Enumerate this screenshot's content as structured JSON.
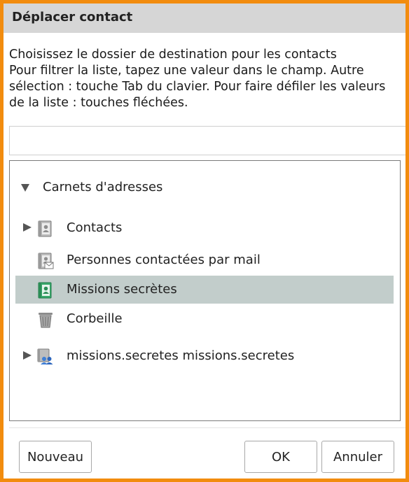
{
  "dialog": {
    "title": "Déplacer contact",
    "instructions": [
      "Choisissez le dossier de destination pour les contacts",
      "Pour filtrer la liste, tapez une valeur dans le champ. Autre",
      "sélection : touche Tab du clavier. Pour faire défiler les valeurs",
      "de la liste : touches fléchées."
    ]
  },
  "filter": {
    "value": "",
    "placeholder": ""
  },
  "tree": {
    "root": {
      "label": "Carnets d'adresses",
      "expanded": true
    },
    "items": [
      {
        "label": "Contacts",
        "icon": "address-book-icon",
        "has_children": true,
        "selected": false
      },
      {
        "label": "Personnes contactées par mail",
        "icon": "emailed-contacts-icon",
        "has_children": false,
        "selected": false
      },
      {
        "label": "Missions secrètes",
        "icon": "address-book-green-icon",
        "has_children": false,
        "selected": true
      },
      {
        "label": "Corbeille",
        "icon": "trash-icon",
        "has_children": false,
        "selected": false
      },
      {
        "label": "missions.secretes missions.secretes",
        "icon": "shared-folder-icon",
        "has_children": true,
        "selected": false
      }
    ]
  },
  "buttons": {
    "new_label": "Nouveau",
    "ok_label": "OK",
    "cancel_label": "Annuler"
  },
  "colors": {
    "frame": "#f28c0e",
    "title_bar": "#d6d6d6",
    "selected_row": "#c2cdcb"
  }
}
